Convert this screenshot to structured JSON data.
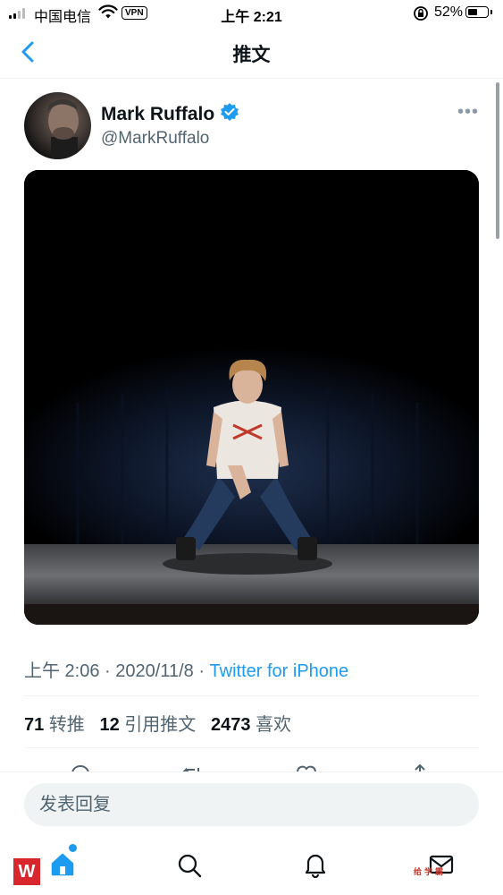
{
  "status_bar": {
    "carrier": "中国电信",
    "vpn": "VPN",
    "time": "上午 2:21",
    "battery": "52%",
    "battery_level": 0.52
  },
  "header": {
    "title": "推文"
  },
  "tweet": {
    "author_name": "Mark Ruffalo",
    "author_handle": "@MarkRuffalo",
    "verified": true,
    "time": "上午 2:06",
    "sep1": " · ",
    "date": "2020/11/8",
    "sep2": " · ",
    "source": "Twitter for iPhone",
    "stats": {
      "retweets": "71",
      "retweets_label": "转推",
      "quotes": "12",
      "quotes_label": "引用推文",
      "likes": "2473",
      "likes_label": "喜欢"
    }
  },
  "reply_bar": {
    "placeholder": "发表回复"
  },
  "tab_bar": {
    "items": [
      {
        "icon": "home-icon"
      },
      {
        "icon": "search-icon"
      },
      {
        "icon": "bell-icon"
      },
      {
        "icon": "mail-icon"
      }
    ],
    "watermark_left": "W",
    "watermark_right": "给学霸"
  },
  "colors": {
    "accent": "#1d9bf0",
    "secondary_text": "#536471",
    "divider": "#eff3f4"
  }
}
